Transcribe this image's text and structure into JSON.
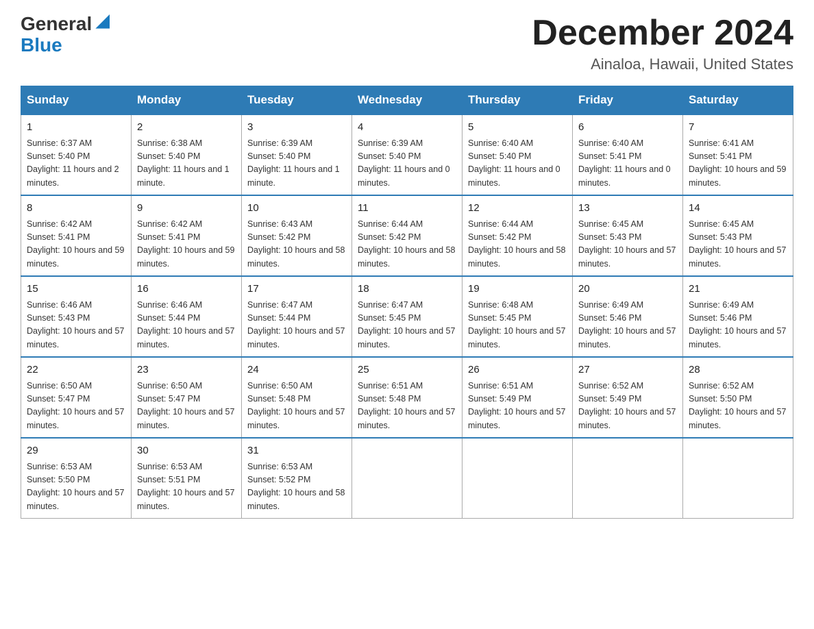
{
  "header": {
    "logo_general": "General",
    "logo_blue": "Blue",
    "title": "December 2024",
    "subtitle": "Ainaloa, Hawaii, United States"
  },
  "weekdays": [
    "Sunday",
    "Monday",
    "Tuesday",
    "Wednesday",
    "Thursday",
    "Friday",
    "Saturday"
  ],
  "weeks": [
    [
      {
        "day": "1",
        "sunrise": "6:37 AM",
        "sunset": "5:40 PM",
        "daylight": "11 hours and 2 minutes."
      },
      {
        "day": "2",
        "sunrise": "6:38 AM",
        "sunset": "5:40 PM",
        "daylight": "11 hours and 1 minute."
      },
      {
        "day": "3",
        "sunrise": "6:39 AM",
        "sunset": "5:40 PM",
        "daylight": "11 hours and 1 minute."
      },
      {
        "day": "4",
        "sunrise": "6:39 AM",
        "sunset": "5:40 PM",
        "daylight": "11 hours and 0 minutes."
      },
      {
        "day": "5",
        "sunrise": "6:40 AM",
        "sunset": "5:40 PM",
        "daylight": "11 hours and 0 minutes."
      },
      {
        "day": "6",
        "sunrise": "6:40 AM",
        "sunset": "5:41 PM",
        "daylight": "11 hours and 0 minutes."
      },
      {
        "day": "7",
        "sunrise": "6:41 AM",
        "sunset": "5:41 PM",
        "daylight": "10 hours and 59 minutes."
      }
    ],
    [
      {
        "day": "8",
        "sunrise": "6:42 AM",
        "sunset": "5:41 PM",
        "daylight": "10 hours and 59 minutes."
      },
      {
        "day": "9",
        "sunrise": "6:42 AM",
        "sunset": "5:41 PM",
        "daylight": "10 hours and 59 minutes."
      },
      {
        "day": "10",
        "sunrise": "6:43 AM",
        "sunset": "5:42 PM",
        "daylight": "10 hours and 58 minutes."
      },
      {
        "day": "11",
        "sunrise": "6:44 AM",
        "sunset": "5:42 PM",
        "daylight": "10 hours and 58 minutes."
      },
      {
        "day": "12",
        "sunrise": "6:44 AM",
        "sunset": "5:42 PM",
        "daylight": "10 hours and 58 minutes."
      },
      {
        "day": "13",
        "sunrise": "6:45 AM",
        "sunset": "5:43 PM",
        "daylight": "10 hours and 57 minutes."
      },
      {
        "day": "14",
        "sunrise": "6:45 AM",
        "sunset": "5:43 PM",
        "daylight": "10 hours and 57 minutes."
      }
    ],
    [
      {
        "day": "15",
        "sunrise": "6:46 AM",
        "sunset": "5:43 PM",
        "daylight": "10 hours and 57 minutes."
      },
      {
        "day": "16",
        "sunrise": "6:46 AM",
        "sunset": "5:44 PM",
        "daylight": "10 hours and 57 minutes."
      },
      {
        "day": "17",
        "sunrise": "6:47 AM",
        "sunset": "5:44 PM",
        "daylight": "10 hours and 57 minutes."
      },
      {
        "day": "18",
        "sunrise": "6:47 AM",
        "sunset": "5:45 PM",
        "daylight": "10 hours and 57 minutes."
      },
      {
        "day": "19",
        "sunrise": "6:48 AM",
        "sunset": "5:45 PM",
        "daylight": "10 hours and 57 minutes."
      },
      {
        "day": "20",
        "sunrise": "6:49 AM",
        "sunset": "5:46 PM",
        "daylight": "10 hours and 57 minutes."
      },
      {
        "day": "21",
        "sunrise": "6:49 AM",
        "sunset": "5:46 PM",
        "daylight": "10 hours and 57 minutes."
      }
    ],
    [
      {
        "day": "22",
        "sunrise": "6:50 AM",
        "sunset": "5:47 PM",
        "daylight": "10 hours and 57 minutes."
      },
      {
        "day": "23",
        "sunrise": "6:50 AM",
        "sunset": "5:47 PM",
        "daylight": "10 hours and 57 minutes."
      },
      {
        "day": "24",
        "sunrise": "6:50 AM",
        "sunset": "5:48 PM",
        "daylight": "10 hours and 57 minutes."
      },
      {
        "day": "25",
        "sunrise": "6:51 AM",
        "sunset": "5:48 PM",
        "daylight": "10 hours and 57 minutes."
      },
      {
        "day": "26",
        "sunrise": "6:51 AM",
        "sunset": "5:49 PM",
        "daylight": "10 hours and 57 minutes."
      },
      {
        "day": "27",
        "sunrise": "6:52 AM",
        "sunset": "5:49 PM",
        "daylight": "10 hours and 57 minutes."
      },
      {
        "day": "28",
        "sunrise": "6:52 AM",
        "sunset": "5:50 PM",
        "daylight": "10 hours and 57 minutes."
      }
    ],
    [
      {
        "day": "29",
        "sunrise": "6:53 AM",
        "sunset": "5:50 PM",
        "daylight": "10 hours and 57 minutes."
      },
      {
        "day": "30",
        "sunrise": "6:53 AM",
        "sunset": "5:51 PM",
        "daylight": "10 hours and 57 minutes."
      },
      {
        "day": "31",
        "sunrise": "6:53 AM",
        "sunset": "5:52 PM",
        "daylight": "10 hours and 58 minutes."
      },
      null,
      null,
      null,
      null
    ]
  ]
}
